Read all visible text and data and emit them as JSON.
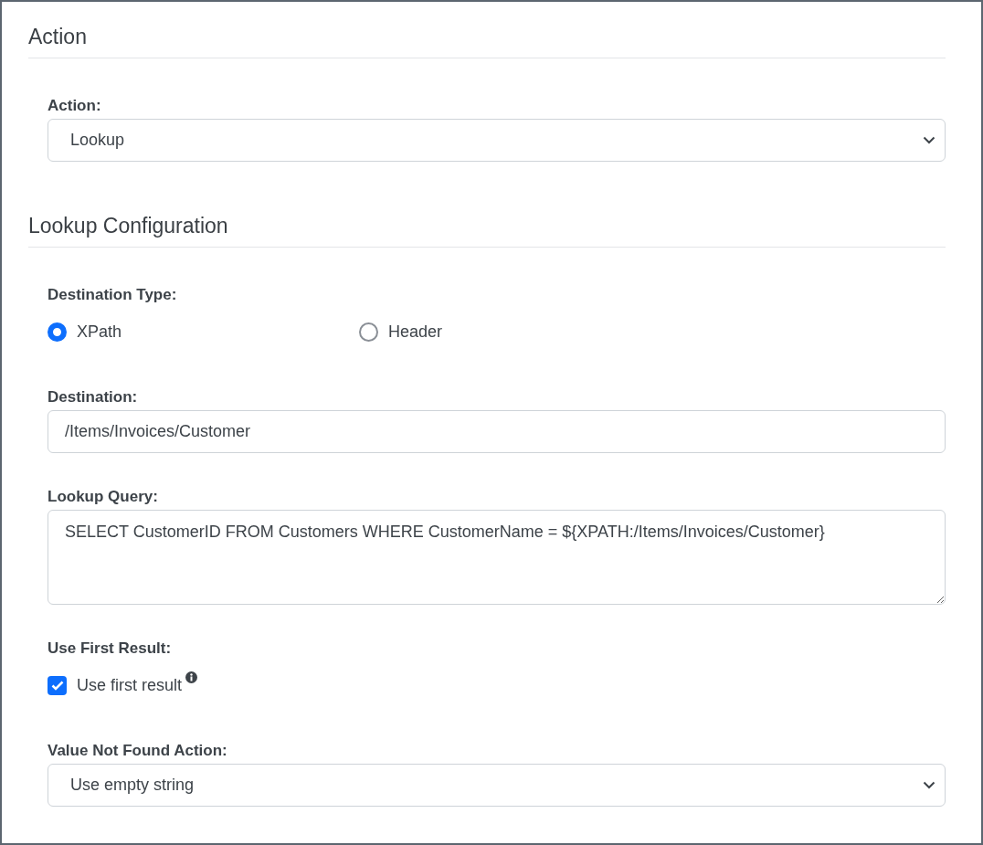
{
  "sections": [
    {
      "title": "Action",
      "fields": [
        {
          "kind": "select",
          "label": "Action:",
          "value": "Lookup"
        }
      ]
    },
    {
      "title": "Lookup Configuration",
      "fields": [
        {
          "kind": "radio",
          "label": "Destination Type:",
          "options": [
            {
              "label": "XPath",
              "selected": true
            },
            {
              "label": "Header",
              "selected": false
            }
          ]
        },
        {
          "kind": "text",
          "label": "Destination:",
          "value": "/Items/Invoices/Customer"
        },
        {
          "kind": "textarea",
          "label": "Lookup Query:",
          "value": "SELECT CustomerID FROM Customers WHERE CustomerName = ${XPATH:/Items/Invoices/Customer}"
        },
        {
          "kind": "checkbox",
          "label": "Use First Result:",
          "option": {
            "label": "Use first result",
            "checked": true
          }
        },
        {
          "kind": "select",
          "label": "Value Not Found Action:",
          "value": "Use empty string"
        }
      ]
    }
  ]
}
